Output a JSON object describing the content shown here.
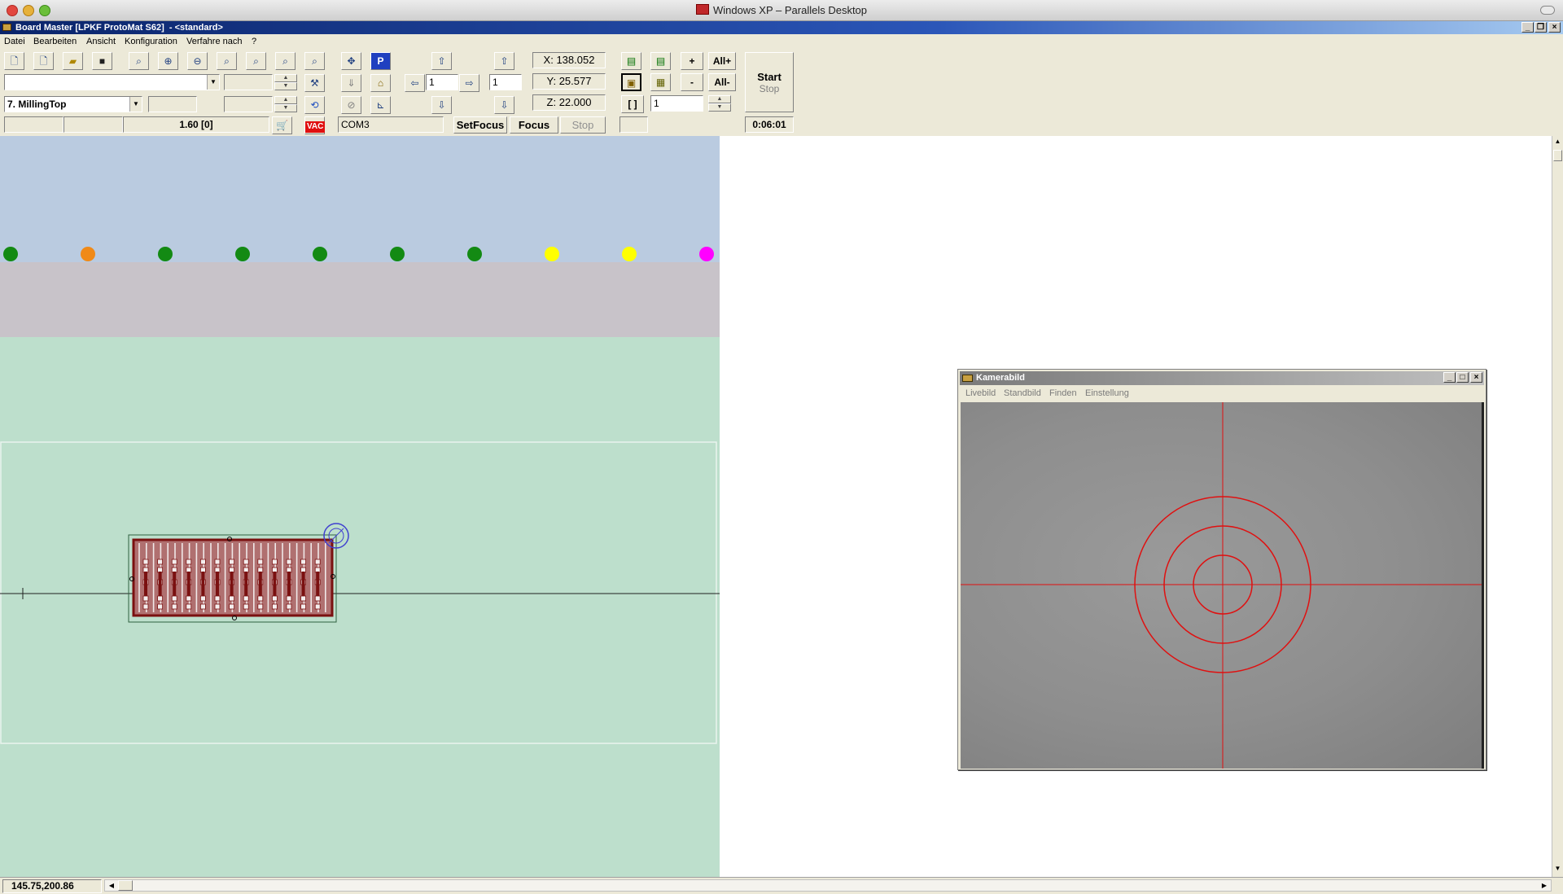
{
  "host": {
    "title": "Windows XP – Parallels Desktop"
  },
  "app": {
    "title": "Board Master [LPKF ProtoMat S62]  - <standard>",
    "menu": [
      "Datei",
      "Bearbeiten",
      "Ansicht",
      "Konfiguration",
      "Verfahre nach",
      "?"
    ]
  },
  "toolbar": {
    "layer_select": "7. MillingTop",
    "tool_select": "",
    "step_x": "1",
    "step_z": "1",
    "repeat_count": "1",
    "x_readout": "X: 138.052",
    "y_readout": "Y: 25.577",
    "z_readout": "Z: 22.000",
    "thickness": "1.60 [0]",
    "port": "COM3",
    "vac_label": "VAC",
    "setfocus_label": "SetFocus",
    "focus_label": "Focus",
    "stop_focus_label": "Stop",
    "plus_label": "+",
    "minus_label": "-",
    "all_plus_label": "All+",
    "all_minus_label": "All-",
    "brackets_label": "[ ]",
    "start_label": "Start",
    "stop_label": "Stop",
    "elapsed": "0:06:01",
    "parking_label": "P"
  },
  "tool_dots": [
    "#138a13",
    "#f08a18",
    "#138a13",
    "#138a13",
    "#138a13",
    "#138a13",
    "#138a13",
    "#ffff00",
    "#ffff00",
    "#ff00ff"
  ],
  "camera": {
    "title": "Kamerabild",
    "menu": [
      "Livebild",
      "Standbild",
      "Finden",
      "Einstellung"
    ]
  },
  "status": {
    "coordinates": "145.75,200.86"
  }
}
